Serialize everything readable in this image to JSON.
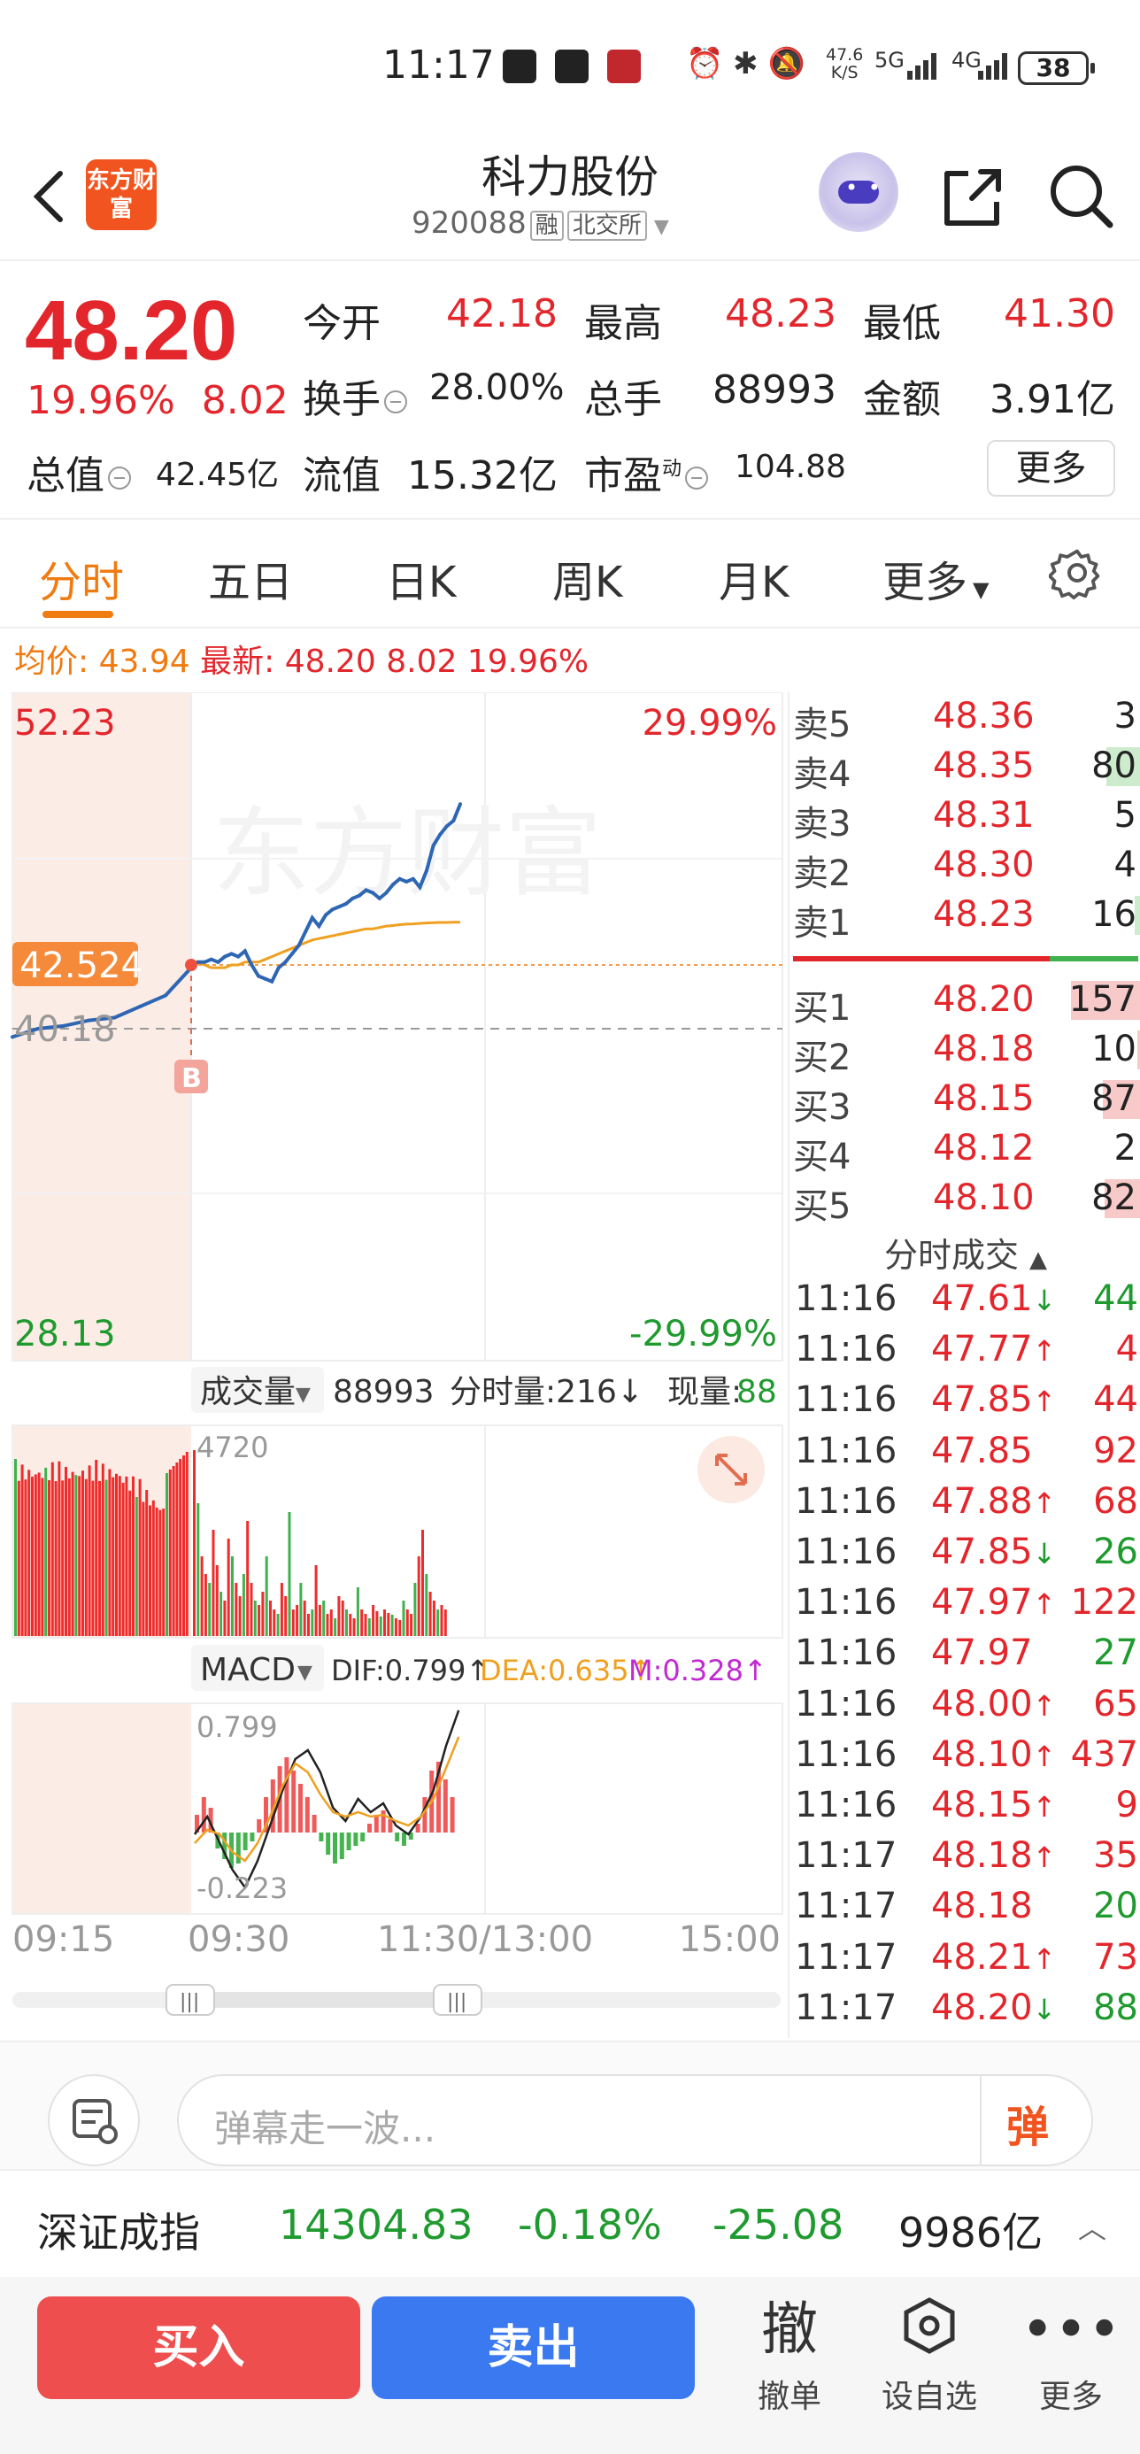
{
  "status_bar": {
    "time": "11:17",
    "net_speed_top": "47.6",
    "net_speed_unit": "K/S",
    "net1": "5G",
    "net2": "4G",
    "battery": "38"
  },
  "header": {
    "logo_text": "东方财富",
    "title": "科力股份",
    "code": "920088",
    "tag_margin": "融",
    "tag_exchange": "北交所"
  },
  "quote": {
    "price": "48.20",
    "change_pct": "19.96%",
    "change_abs": "8.02",
    "open_label": "今开",
    "open": "42.18",
    "high_label": "最高",
    "high": "48.23",
    "low_label": "最低",
    "low": "41.30",
    "turnover_label": "换手",
    "turnover": "28.00%",
    "volume_label": "总手",
    "volume": "88993",
    "amount_label": "金额",
    "amount": "3.91亿",
    "mktcap_label": "总值",
    "mktcap": "42.45亿",
    "float_label": "流值",
    "float_cap": "15.32亿",
    "pe_label": "市盈",
    "pe_sup": "动",
    "pe": "104.88",
    "more_label": "更多"
  },
  "tabs": [
    "分时",
    "五日",
    "日K",
    "周K",
    "月K",
    "更多"
  ],
  "avg_line": {
    "avg_label": "均价:",
    "avg": "43.94",
    "latest_label": "最新:",
    "latest": "48.20",
    "chg": "8.02",
    "pct": "19.96%"
  },
  "chart": {
    "y_top": "52.23",
    "y_top_pct": "29.99%",
    "y_bottom": "28.13",
    "y_bottom_pct": "-29.99%",
    "open_price_tag": "42.524",
    "prev_close": "40.18",
    "b_marker": "B",
    "watermark": "东方财富",
    "volume_selector": "成交量",
    "volume_total": "88993",
    "period_volume_label": "分时量:216↓",
    "current_volume_label": "现量:",
    "current_volume": "88",
    "volume_max_label": "4720",
    "macd_selector": "MACD",
    "dif_label": "DIF:0.799↑",
    "dea_label": "DEA:0.635↑",
    "m_label": "M:0.328↑",
    "macd_top": "0.799",
    "macd_bottom": "-0.223",
    "time_labels": [
      "09:15",
      "09:30",
      "11:30/13:00",
      "15:00"
    ]
  },
  "chart_data": {
    "type": "line",
    "title": "",
    "xlabel": "",
    "ylabel": "",
    "ylim": [
      28.13,
      52.23
    ],
    "prev_close": 40.18,
    "series": [
      {
        "name": "",
        "values": [
          39.8,
          40.1,
          40.2,
          40.4,
          40.5,
          40.9,
          41.3,
          42.3,
          42.5,
          42.5,
          42.6,
          42.5,
          42.7,
          42.8,
          42.7,
          42.9,
          42.4,
          42.0,
          41.9,
          41.8,
          42.3,
          42.5,
          42.8,
          43.1,
          43.6,
          44.1,
          43.8,
          44.2,
          44.4,
          44.5,
          44.6,
          44.8,
          44.9,
          45.1,
          45.0,
          44.8,
          45.0,
          45.3,
          45.5,
          45.4,
          45.5,
          45.2,
          45.8,
          46.7,
          47.1,
          47.4,
          47.6,
          48.2
        ]
      },
      {
        "name": "",
        "values": [
          null,
          null,
          null,
          null,
          null,
          null,
          null,
          42.5,
          42.5,
          42.4,
          42.3,
          42.3,
          42.3,
          42.4,
          42.4,
          42.5,
          42.5,
          42.5,
          42.6,
          42.7,
          42.8,
          42.9,
          43.0,
          43.1,
          43.2,
          43.3,
          43.35,
          43.4,
          43.45,
          43.5,
          43.55,
          43.6,
          43.65,
          43.7,
          43.7,
          43.75,
          43.8,
          43.82,
          43.85,
          43.87,
          43.88,
          43.9,
          43.91,
          43.92,
          43.93,
          43.93,
          43.94,
          43.94
        ]
      }
    ]
  },
  "order_book": {
    "asks": [
      {
        "label": "卖5",
        "price": "48.36",
        "vol": "3",
        "bar": 0
      },
      {
        "label": "卖4",
        "price": "48.35",
        "vol": "80",
        "bar": 0.5
      },
      {
        "label": "卖3",
        "price": "48.31",
        "vol": "5",
        "bar": 0.03
      },
      {
        "label": "卖2",
        "price": "48.30",
        "vol": "4",
        "bar": 0.03
      },
      {
        "label": "卖1",
        "price": "48.23",
        "vol": "16",
        "bar": 0.1
      }
    ],
    "bids": [
      {
        "label": "买1",
        "price": "48.20",
        "vol": "157",
        "bar": 1
      },
      {
        "label": "买2",
        "price": "48.18",
        "vol": "10",
        "bar": 0.06
      },
      {
        "label": "买3",
        "price": "48.15",
        "vol": "87",
        "bar": 0.55
      },
      {
        "label": "买4",
        "price": "48.12",
        "vol": "2",
        "bar": 0.01
      },
      {
        "label": "买5",
        "price": "48.10",
        "vol": "82",
        "bar": 0.52
      }
    ],
    "trade_title": "分时成交",
    "trades": [
      {
        "t": "11:16",
        "p": "47.61",
        "arrow": "↓",
        "v": "44",
        "pc": "red",
        "vc": "green"
      },
      {
        "t": "11:16",
        "p": "47.77",
        "arrow": "↑",
        "v": "4",
        "pc": "red",
        "vc": "red"
      },
      {
        "t": "11:16",
        "p": "47.85",
        "arrow": "↑",
        "v": "44",
        "pc": "red",
        "vc": "red"
      },
      {
        "t": "11:16",
        "p": "47.85",
        "arrow": "",
        "v": "92",
        "pc": "red",
        "vc": "red"
      },
      {
        "t": "11:16",
        "p": "47.88",
        "arrow": "↑",
        "v": "68",
        "pc": "red",
        "vc": "red"
      },
      {
        "t": "11:16",
        "p": "47.85",
        "arrow": "↓",
        "v": "26",
        "pc": "red",
        "vc": "green"
      },
      {
        "t": "11:16",
        "p": "47.97",
        "arrow": "↑",
        "v": "122",
        "pc": "red",
        "vc": "red"
      },
      {
        "t": "11:16",
        "p": "47.97",
        "arrow": "",
        "v": "27",
        "pc": "red",
        "vc": "green"
      },
      {
        "t": "11:16",
        "p": "48.00",
        "arrow": "↑",
        "v": "65",
        "pc": "red",
        "vc": "red"
      },
      {
        "t": "11:16",
        "p": "48.10",
        "arrow": "↑",
        "v": "437",
        "pc": "red",
        "vc": "red"
      },
      {
        "t": "11:16",
        "p": "48.15",
        "arrow": "↑",
        "v": "9",
        "pc": "red",
        "vc": "red"
      },
      {
        "t": "11:17",
        "p": "48.18",
        "arrow": "↑",
        "v": "35",
        "pc": "red",
        "vc": "red"
      },
      {
        "t": "11:17",
        "p": "48.18",
        "arrow": "",
        "v": "20",
        "pc": "red",
        "vc": "green"
      },
      {
        "t": "11:17",
        "p": "48.21",
        "arrow": "↑",
        "v": "73",
        "pc": "red",
        "vc": "red"
      },
      {
        "t": "11:17",
        "p": "48.20",
        "arrow": "↓",
        "v": "88",
        "pc": "red",
        "vc": "green"
      }
    ]
  },
  "danmu": {
    "placeholder": "弹幕走一波...",
    "button": "弹"
  },
  "index_bar": {
    "name": "深证成指",
    "value": "14304.83",
    "pct": "-0.18%",
    "chg": "-25.08",
    "amount": "9986亿"
  },
  "bottom_bar": {
    "buy": "买入",
    "sell": "卖出",
    "cancel_icon": "撤",
    "cancel": "撤单",
    "watch": "设自选",
    "more": "更多"
  },
  "colors": {
    "up": "#e3262c",
    "down": "#1f9a2f",
    "accent": "#f07b10",
    "price_line": "#2e66b4",
    "avg_line": "#f0a020"
  }
}
